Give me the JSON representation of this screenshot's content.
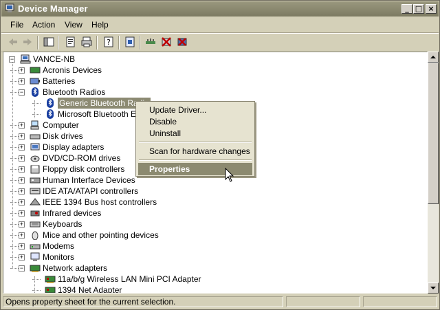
{
  "window": {
    "title": "Device Manager"
  },
  "title_buttons": {
    "minimize": "_",
    "maximize": "□",
    "close": "×"
  },
  "menu": [
    "File",
    "Action",
    "View",
    "Help"
  ],
  "toolbar_icons": [
    "back-arrow-icon",
    "forward-arrow-icon",
    "show-hide-tree-icon",
    "properties-icon",
    "print-icon",
    "help-icon",
    "update-driver-icon",
    "scan-hardware-icon",
    "disable-device-icon",
    "uninstall-device-icon"
  ],
  "tree": {
    "root": "VANCE-NB",
    "nodes": [
      {
        "label": "Acronis Devices",
        "expanded": false,
        "icon": "generic-device-icon"
      },
      {
        "label": "Batteries",
        "expanded": false,
        "icon": "battery-icon"
      },
      {
        "label": "Bluetooth Radios",
        "expanded": true,
        "icon": "bluetooth-icon"
      },
      {
        "label": "Generic Bluetooth Radio",
        "child": true,
        "selected": true,
        "icon": "bluetooth-icon"
      },
      {
        "label": "Microsoft Bluetooth Enumerator",
        "child": true,
        "icon": "bluetooth-icon"
      },
      {
        "label": "Computer",
        "expanded": false,
        "icon": "computer-icon"
      },
      {
        "label": "Disk drives",
        "expanded": false,
        "icon": "disk-drive-icon"
      },
      {
        "label": "Display adapters",
        "expanded": false,
        "icon": "display-adapter-icon"
      },
      {
        "label": "DVD/CD-ROM drives",
        "expanded": false,
        "icon": "dvd-icon"
      },
      {
        "label": "Floppy disk controllers",
        "expanded": false,
        "icon": "floppy-icon"
      },
      {
        "label": "Human Interface Devices",
        "expanded": false,
        "icon": "hid-icon"
      },
      {
        "label": "IDE ATA/ATAPI controllers",
        "expanded": false,
        "icon": "ide-controller-icon"
      },
      {
        "label": "IEEE 1394 Bus host controllers",
        "expanded": false,
        "icon": "ieee1394-icon"
      },
      {
        "label": "Infrared devices",
        "expanded": false,
        "icon": "infrared-icon"
      },
      {
        "label": "Keyboards",
        "expanded": false,
        "icon": "keyboard-icon"
      },
      {
        "label": "Mice and other pointing devices",
        "expanded": false,
        "icon": "mouse-icon"
      },
      {
        "label": "Modems",
        "expanded": false,
        "icon": "modem-icon"
      },
      {
        "label": "Monitors",
        "expanded": false,
        "icon": "monitor-icon"
      },
      {
        "label": "Network adapters",
        "expanded": true,
        "icon": "network-adapter-icon"
      },
      {
        "label": "11a/b/g Wireless LAN Mini PCI Adapter",
        "child": true,
        "icon": "network-card-icon"
      },
      {
        "label": "1394 Net Adapter",
        "child": true,
        "icon": "network-card-icon"
      }
    ]
  },
  "context_menu": {
    "items": [
      "Update Driver...",
      "Disable",
      "Uninstall"
    ],
    "scan": "Scan for hardware changes",
    "properties": "Properties"
  },
  "status": {
    "text": "Opens property sheet for the current selection."
  },
  "colors": {
    "title": "#8a886e",
    "selection": "#8c8a72",
    "menu_bg": "#e6e3d0"
  }
}
